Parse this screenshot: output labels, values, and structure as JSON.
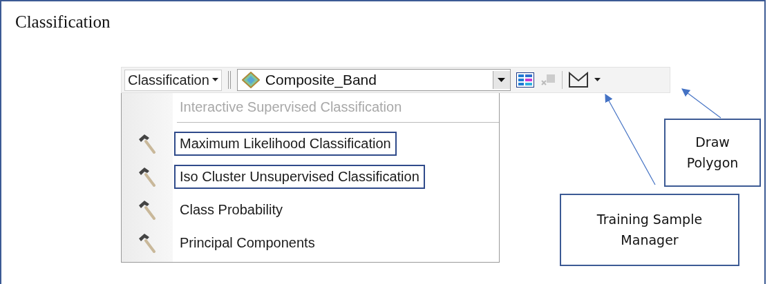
{
  "heading": "Classification",
  "toolbar": {
    "menu_button": "Classification",
    "layer_dropdown": {
      "value": "Composite_Band"
    }
  },
  "menu": {
    "items": [
      {
        "label": "Interactive Supervised Classification",
        "disabled": true,
        "outlined": false
      },
      {
        "label": "Maximum Likelihood Classification",
        "disabled": false,
        "outlined": true
      },
      {
        "label": "Iso Cluster Unsupervised Classification",
        "disabled": false,
        "outlined": true
      },
      {
        "label": "Class Probability",
        "disabled": false,
        "outlined": false
      },
      {
        "label": "Principal Components",
        "disabled": false,
        "outlined": false
      }
    ]
  },
  "callouts": [
    {
      "text": "Draw Polygon"
    },
    {
      "text": "Training Sample Manager"
    }
  ]
}
